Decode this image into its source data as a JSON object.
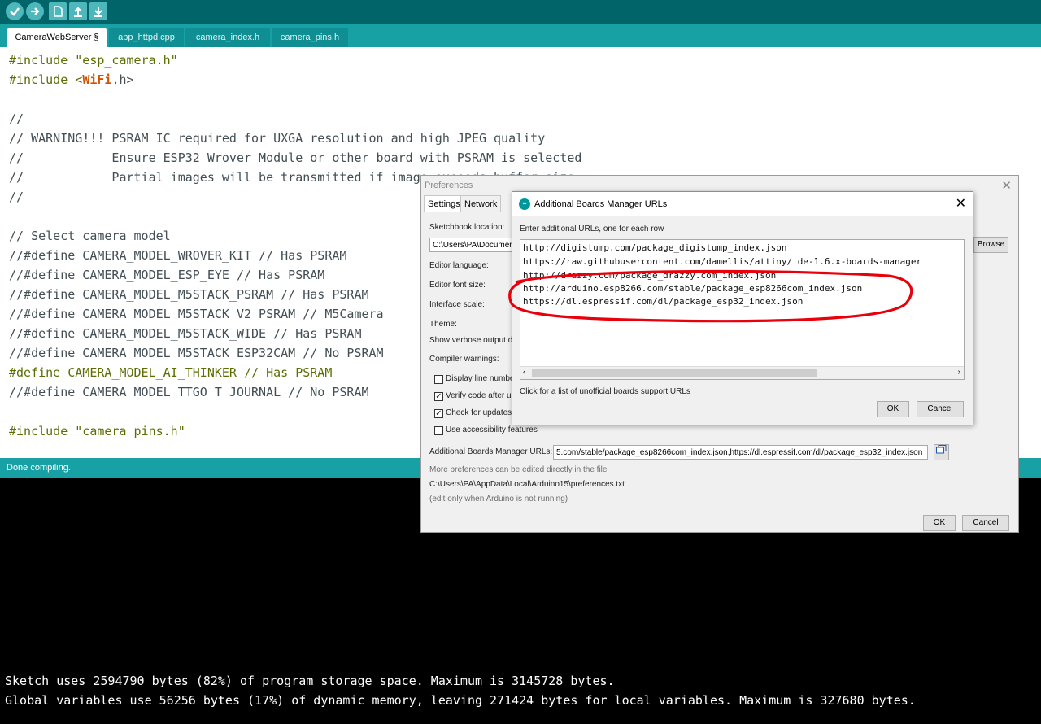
{
  "toolbar": {
    "buttons": [
      {
        "name": "verify",
        "icon": "check-icon"
      },
      {
        "name": "upload",
        "icon": "arrow-right-icon"
      },
      {
        "name": "new",
        "icon": "new-file-icon"
      },
      {
        "name": "open",
        "icon": "arrow-up-icon"
      },
      {
        "name": "save",
        "icon": "arrow-down-icon"
      }
    ]
  },
  "tabs": [
    {
      "label": "CameraWebServer §",
      "active": true
    },
    {
      "label": "app_httpd.cpp",
      "active": false
    },
    {
      "label": "camera_index.h",
      "active": false
    },
    {
      "label": "camera_pins.h",
      "active": false
    }
  ],
  "editor": {
    "lines": [
      "#include \"esp_camera.h\"",
      "#include <WiFi.h>",
      "",
      "//",
      "// WARNING!!! PSRAM IC required for UXGA resolution and high JPEG quality",
      "//            Ensure ESP32 Wrover Module or other board with PSRAM is selected",
      "//            Partial images will be transmitted if image exceeds buffer size",
      "//",
      "",
      "// Select camera model",
      "//#define CAMERA_MODEL_WROVER_KIT // Has PSRAM",
      "//#define CAMERA_MODEL_ESP_EYE // Has PSRAM",
      "//#define CAMERA_MODEL_M5STACK_PSRAM // Has PSRAM",
      "//#define CAMERA_MODEL_M5STACK_V2_PSRAM // M5Camera",
      "//#define CAMERA_MODEL_M5STACK_WIDE // Has PSRAM",
      "//#define CAMERA_MODEL_M5STACK_ESP32CAM // No PSRAM",
      "#define CAMERA_MODEL_AI_THINKER // Has PSRAM",
      "//#define CAMERA_MODEL_TTGO_T_JOURNAL // No PSRAM",
      "",
      "#include \"camera_pins.h\""
    ]
  },
  "status": {
    "text": "Done compiling."
  },
  "console": {
    "lines": [
      "Sketch uses 2594790 bytes (82%) of program storage space. Maximum is 3145728 bytes.",
      "Global variables use 56256 bytes (17%) of dynamic memory, leaving 271424 bytes for local variables. Maximum is 327680 bytes."
    ]
  },
  "prefs": {
    "title": "Preferences",
    "tabs": [
      "Settings",
      "Network"
    ],
    "sketchbook_label": "Sketchbook location:",
    "sketchbook_value": "C:\\Users\\PA\\Documen",
    "browse_label": "Browse",
    "editor_language_label": "Editor language:",
    "font_size_label": "Editor font size:",
    "interface_scale_label": "Interface scale:",
    "theme_label": "Theme:",
    "verbose_label": "Show verbose output d",
    "compiler_warnings_label": "Compiler warnings:",
    "checkboxes": [
      {
        "label": "Display line number",
        "checked": false
      },
      {
        "label": "Verify code after u",
        "checked": true
      },
      {
        "label": "Check for updates",
        "checked": true
      },
      {
        "label": "Use accessibility features",
        "checked": false
      }
    ],
    "urls_label": "Additional Boards Manager URLs:",
    "urls_value": "5.com/stable/package_esp8266com_index.json,https://dl.espressif.com/dl/package_esp32_index.json",
    "more_prefs": "More preferences can be edited directly in the file",
    "prefs_path": "C:\\Users\\PA\\AppData\\Local\\Arduino15\\preferences.txt",
    "edit_note": "(edit only when Arduino is not running)",
    "ok_label": "OK",
    "cancel_label": "Cancel"
  },
  "abm": {
    "title": "Additional Boards Manager URLs",
    "instructions": "Enter additional URLs, one for each row",
    "urls": [
      "http://digistump.com/package_digistump_index.json",
      "https://raw.githubusercontent.com/damellis/attiny/ide-1.6.x-boards-manager",
      "http://drazzy.com/package_drazzy.com_index.json",
      "http://arduino.esp8266.com/stable/package_esp8266com_index.json",
      "https://dl.espressif.com/dl/package_esp32_index.json"
    ],
    "link_text": "Click for a list of unofficial boards support URLs",
    "ok_label": "OK",
    "cancel_label": "Cancel"
  },
  "colors": {
    "teal_dark": "#006468",
    "teal": "#17a1a5",
    "annotation_red": "#e8000b"
  }
}
